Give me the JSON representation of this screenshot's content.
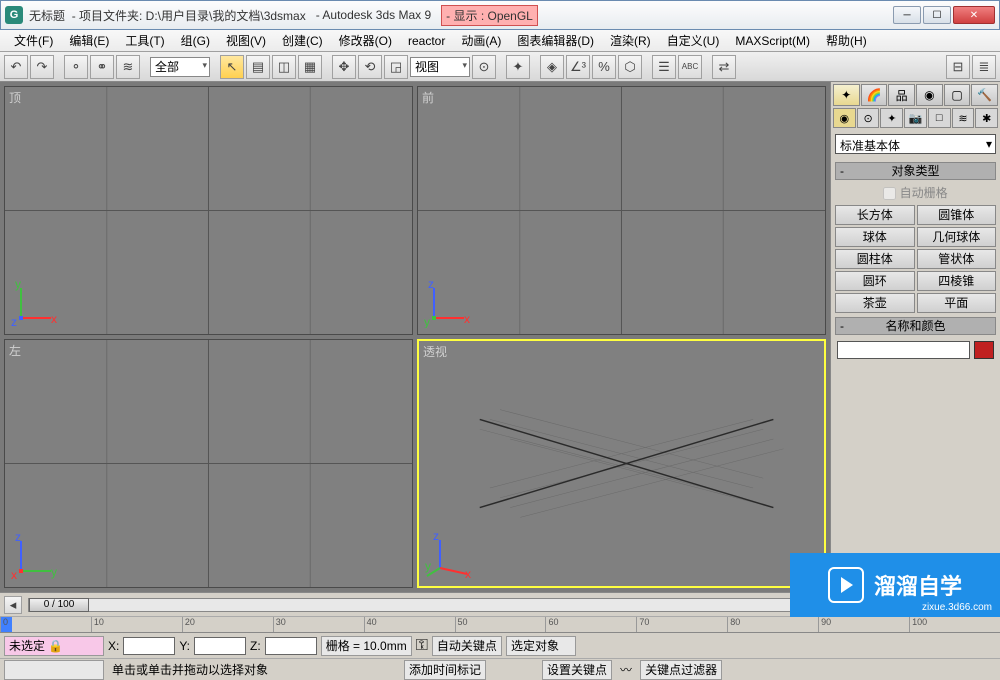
{
  "titlebar": {
    "untitled": "无标题",
    "project_label": "- 项目文件夹: D:\\用户目录\\我的文档\\3dsmax",
    "app": "- Autodesk 3ds Max 9",
    "display": "- 显示 : OpenGL"
  },
  "menu": [
    "文件(F)",
    "编辑(E)",
    "工具(T)",
    "组(G)",
    "视图(V)",
    "创建(C)",
    "修改器(O)",
    "reactor",
    "动画(A)",
    "图表编辑器(D)",
    "渲染(R)",
    "自定义(U)",
    "MAXScript(M)",
    "帮助(H)"
  ],
  "toolbar": {
    "combo_all": "全部",
    "combo_view": "视图"
  },
  "viewports": {
    "tl": "顶",
    "tr": "前",
    "bl": "左",
    "br": "透视"
  },
  "panel": {
    "category_combo": "标准基本体",
    "rollout_objtype": "对象类型",
    "autogrid": "自动栅格",
    "prims": [
      "长方体",
      "圆锥体",
      "球体",
      "几何球体",
      "圆柱体",
      "管状体",
      "圆环",
      "四棱锥",
      "茶壶",
      "平面"
    ],
    "rollout_namecolor": "名称和颜色"
  },
  "timeline": {
    "thumb": "0 / 100",
    "ticks": [
      "0",
      "10",
      "20",
      "30",
      "40",
      "50",
      "60",
      "70",
      "80",
      "90",
      "100"
    ]
  },
  "status": {
    "noselect": "未选定",
    "x_label": "X:",
    "y_label": "Y:",
    "z_label": "Z:",
    "grid": "栅格 = 10.0mm",
    "autokey": "自动关键点",
    "selobj": "选定对象",
    "hint": "单击或单击并拖动以选择对象",
    "addmarker": "添加时间标记",
    "setkey": "设置关键点",
    "keyfilter": "关键点过滤器"
  },
  "watermark": {
    "brand": "溜溜自学",
    "url": "zixue.3d66.com"
  }
}
